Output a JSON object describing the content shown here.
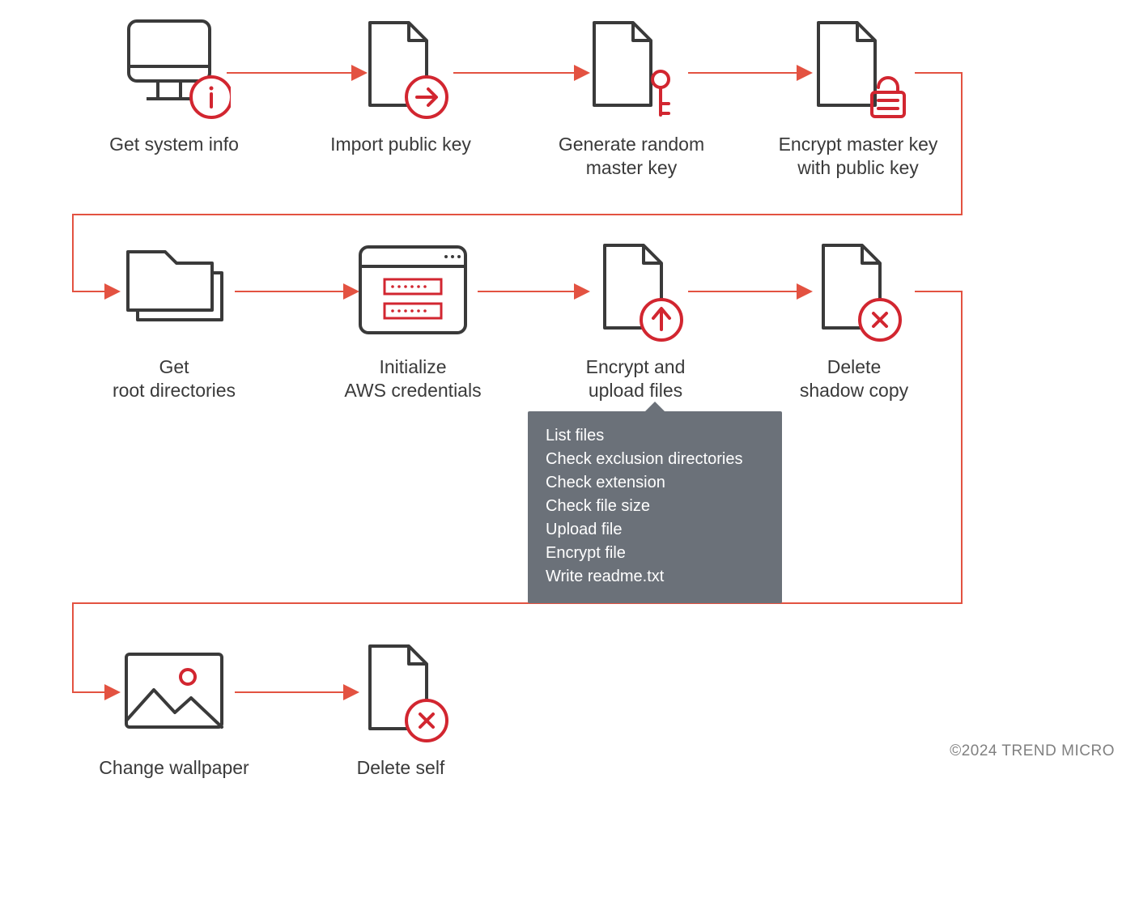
{
  "colors": {
    "ink": "#3a3a3a",
    "accent": "#d22630",
    "arrow": "#e35241",
    "tooltip_bg": "#6b7179"
  },
  "nodes": {
    "sys_info": {
      "label": "Get system info"
    },
    "import_pub": {
      "label": "Import public key"
    },
    "gen_master": {
      "label": "Generate random\nmaster key"
    },
    "encrypt_master": {
      "label": "Encrypt master key\nwith public key"
    },
    "get_root": {
      "label": "Get\nroot directories"
    },
    "init_aws": {
      "label": "Initialize\nAWS credentials"
    },
    "encrypt_upload": {
      "label": "Encrypt and\nupload files"
    },
    "delete_shadow": {
      "label": "Delete\nshadow copy"
    },
    "change_wall": {
      "label": "Change wallpaper"
    },
    "delete_self": {
      "label": "Delete self"
    }
  },
  "tooltip": {
    "items": [
      "List files",
      "Check exclusion directories",
      "Check extension",
      "Check file size",
      "Upload file",
      "Encrypt file",
      "Write readme.txt"
    ]
  },
  "copyright": "©2024 TREND MICRO"
}
